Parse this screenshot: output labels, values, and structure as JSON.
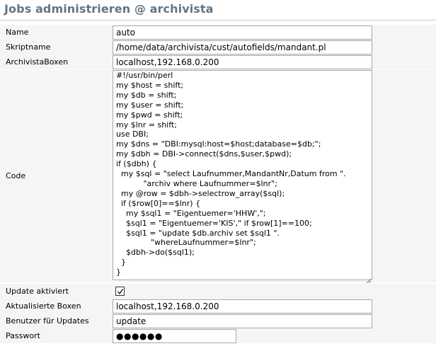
{
  "page": {
    "title": "Jobs administrieren @ archivista"
  },
  "form": {
    "name": {
      "label": "Name",
      "value": "auto"
    },
    "skriptname": {
      "label": "Skriptname",
      "value": "/home/data/archivista/cust/autofields/mandant.pl"
    },
    "archivista_boxen": {
      "label": "ArchivistaBoxen",
      "value": "localhost,192.168.0.200"
    },
    "code": {
      "label": "Code",
      "value": "#!/usr/bin/perl\nmy $host = shift;\nmy $db = shift;\nmy $user = shift;\nmy $pwd = shift;\nmy $lnr = shift;\nuse DBI;\nmy $dns = \"DBI:mysql:host=$host;database=$db;\";\nmy $dbh = DBI->connect($dns,$user,$pwd);\nif ($dbh) {\n  my $sql = \"select Laufnummer,MandantNr,Datum from \".\n           \"archiv where Laufnummer=$lnr\";\n  my @row = $dbh->selectrow_array($sql);\n  if ($row[0]==$lnr) {\n    my $sql1 = \"Eigentuemer='HHW',\";\n    $sql1 = \"Eigentuemer='KIS',\" if $row[1]==100;\n    $sql1 = \"update $db.archiv set $sql1 \".\n              \"whereLaufnummer=$lnr\";\n    $dbh->do($sql1);\n  }\n}"
    },
    "update_aktiviert": {
      "label": "Update aktiviert",
      "checked": true
    },
    "aktualisierte_boxen": {
      "label": "Aktualisierte Boxen",
      "value": "localhost,192.168.0.200"
    },
    "benutzer": {
      "label": "Benutzer für Updates",
      "value": "update"
    },
    "passwort": {
      "label": "Passwort",
      "value": "●●●●●●"
    }
  },
  "colors": {
    "title": "#5f7586",
    "row_background": "#f5f5f5",
    "field_border": "#a8a8a8"
  }
}
